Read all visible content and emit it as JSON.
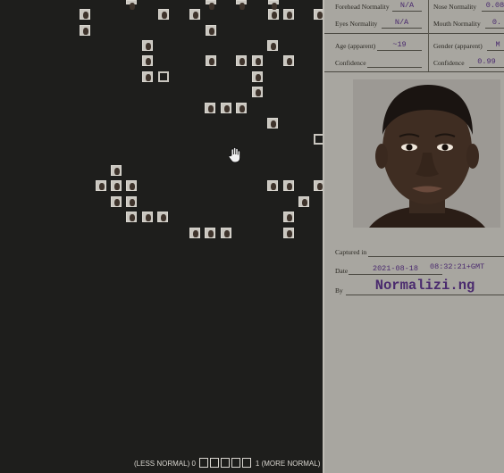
{
  "legend": {
    "less_label": "(LESS NORMAL) 0",
    "more_label": "1 (MORE NORMAL)",
    "swatch_count": 5
  },
  "card": {
    "forehead_label": "Forehead Normality",
    "forehead_value": "N/A",
    "nose_label": "Nose Normality",
    "nose_value": "0.08",
    "eyes_label": "Eyes Normality",
    "eyes_value": "N/A",
    "mouth_label": "Mouth Normality",
    "mouth_value": "0.",
    "age_label": "Age (apparent)",
    "age_value": "~19",
    "gender_label": "Gender (apparent)",
    "gender_value": "M",
    "confidence_label_left": "Confidence",
    "confidence_value_left": "",
    "confidence_label_right": "Confidence",
    "confidence_value_right": "0.99",
    "captured_label": "Captured in",
    "captured_value": "",
    "date_label": "Date",
    "date_value": "2021-08-18",
    "time_value": "08:32:21+GMT",
    "by_label": "By",
    "by_value": "Normalizi.ng"
  },
  "colors": {
    "background": "#1e1e1c",
    "card": "#a8a6a0",
    "ink": "#4a2a6e"
  },
  "icons": [
    "hand-cursor-icon"
  ]
}
